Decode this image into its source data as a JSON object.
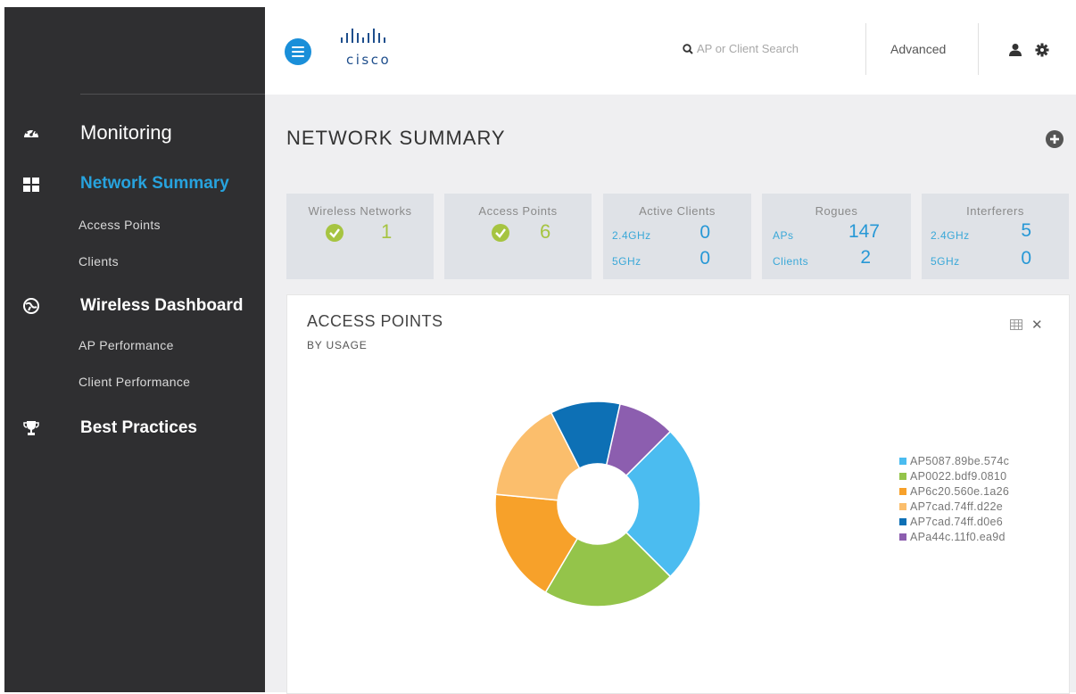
{
  "sidebar": {
    "sections": [
      {
        "label": "Monitoring",
        "icon": "speedometer-icon"
      },
      {
        "label": "Network Summary",
        "icon": "grid-icon",
        "active": true
      },
      {
        "label": "Wireless Dashboard",
        "icon": "dashboard-globe-icon"
      },
      {
        "label": "Best Practices",
        "icon": "trophy-icon"
      }
    ],
    "network_summary_items": [
      "Access Points",
      "Clients"
    ],
    "wireless_dashboard_items": [
      "AP Performance",
      "Client Performance"
    ]
  },
  "header": {
    "logo_text": "cisco",
    "search_placeholder": "AP or Client Search",
    "advanced_label": "Advanced"
  },
  "page": {
    "title": "NETWORK SUMMARY"
  },
  "cards": {
    "wireless_networks": {
      "title": "Wireless Networks",
      "value": "1"
    },
    "access_points": {
      "title": "Access Points",
      "value": "6"
    },
    "active_clients": {
      "title": "Active Clients",
      "rows": [
        {
          "label": "2.4GHz",
          "value": "0"
        },
        {
          "label": "5GHz",
          "value": "0"
        }
      ]
    },
    "rogues": {
      "title": "Rogues",
      "rows": [
        {
          "label": "APs",
          "value": "147"
        },
        {
          "label": "Clients",
          "value": "2"
        }
      ]
    },
    "interferers": {
      "title": "Interferers",
      "rows": [
        {
          "label": "2.4GHz",
          "value": "5"
        },
        {
          "label": "5GHz",
          "value": "0"
        }
      ]
    }
  },
  "panel": {
    "title": "ACCESS POINTS",
    "subtitle": "BY USAGE"
  },
  "colors": {
    "accent": "#1a8fd9",
    "ok_green": "#a6c441",
    "value_blue": "#2798d6"
  },
  "chart_data": {
    "type": "pie",
    "donut": true,
    "legend_position": "right",
    "series": [
      {
        "name": "AP5087.89be.574c",
        "value": 25,
        "color": "#4bbcf0"
      },
      {
        "name": "AP0022.bdf9.0810",
        "value": 21,
        "color": "#94c44a"
      },
      {
        "name": "AP6c20.560e.1a26",
        "value": 18,
        "color": "#f7a12a"
      },
      {
        "name": "AP7cad.74ff.d22e",
        "value": 16,
        "color": "#fbbe6c"
      },
      {
        "name": "AP7cad.74ff.d0e6",
        "value": 11,
        "color": "#0d70b5"
      },
      {
        "name": "APa44c.11f0.ea9d",
        "value": 9,
        "color": "#8c5eaf"
      }
    ]
  }
}
